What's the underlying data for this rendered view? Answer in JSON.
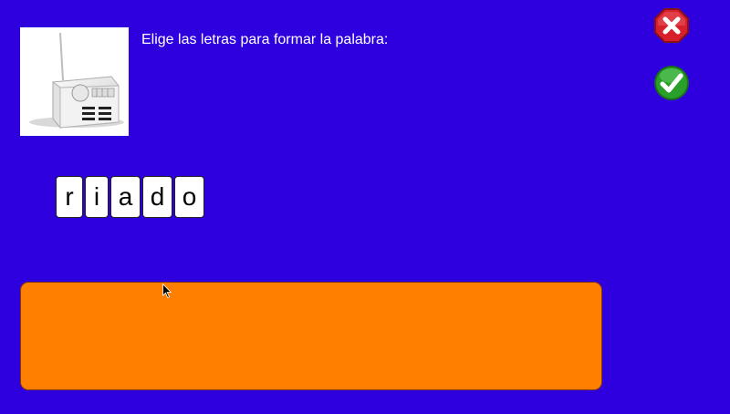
{
  "picture": {
    "icon": "radio-icon"
  },
  "instruction": "Elige las letras para formar la palabra:",
  "buttons": {
    "cancel_icon": "close-icon",
    "confirm_icon": "check-icon"
  },
  "letters": [
    "r",
    "i",
    "a",
    "d",
    "o"
  ],
  "answer": "",
  "colors": {
    "background": "#2e00dd",
    "answer_box": "#ff8000",
    "cancel": "#d8202a",
    "confirm": "#2aa02a"
  }
}
